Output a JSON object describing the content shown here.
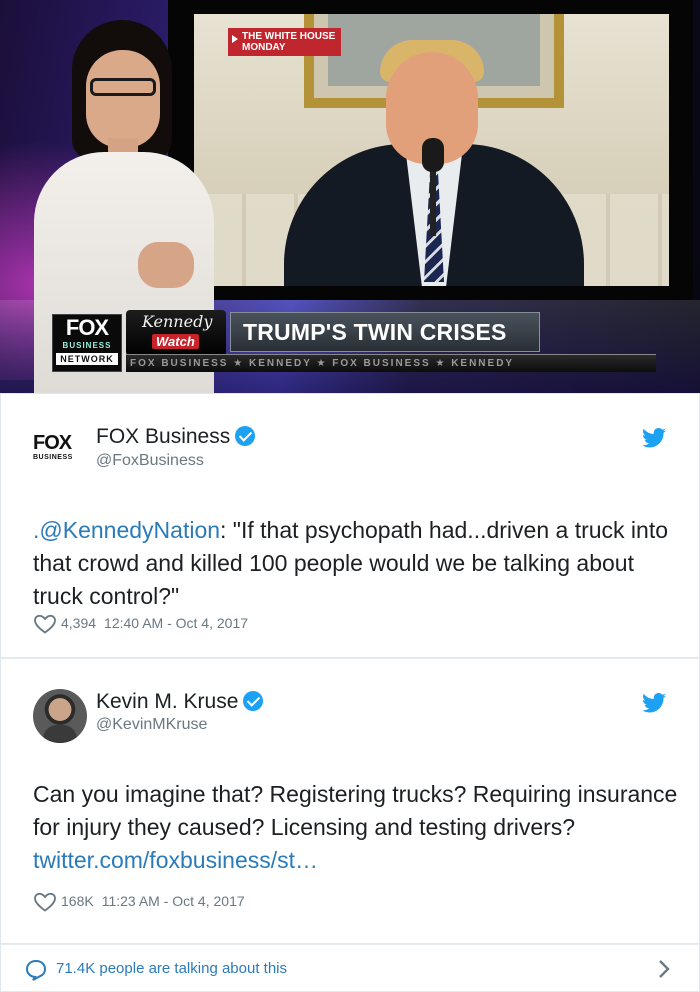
{
  "broadcast": {
    "location_tag_line1": "THE WHITE HOUSE",
    "location_tag_line2": "MONDAY",
    "network_logo_main": "FOX",
    "network_logo_sub": "BUSINESS",
    "network_logo_bottom": "NETWORK",
    "show_logo_script": "Kennedy",
    "show_logo_word": "Watch",
    "headline": "TRUMP'S TWIN CRISES",
    "ticker": "FOX BUSINESS  ★  KENNEDY  ★  FOX BUSINESS  ★  KENNEDY"
  },
  "tweets": [
    {
      "avatar_logo_main": "FOX",
      "avatar_logo_sub": "BUSINESS",
      "name": "FOX Business",
      "handle": "@FoxBusiness",
      "text_mention": ".@KennedyNation",
      "text_body": ": \"If that psychopath had...driven a truck into that crowd and killed 100 people would we be talking about truck control?\"",
      "likes": "4,394",
      "timestamp": "12:40 AM - Oct 4, 2017"
    },
    {
      "name": "Kevin M. Kruse",
      "handle": "@KevinMKruse",
      "text_body": "Can you imagine that? Registering trucks? Requiring insurance for injury they caused? Licensing and testing drivers? ",
      "text_link": "twitter.com/foxbusiness/st…",
      "likes": "168K",
      "timestamp": "11:23 AM - Oct 4, 2017"
    }
  ],
  "footer": {
    "talking_text": "71.4K people are talking about this"
  },
  "colors": {
    "link": "#2b7bb9",
    "verified": "#1da1f2",
    "twitter_bird": "#1da1f2",
    "muted_text": "#697882"
  }
}
